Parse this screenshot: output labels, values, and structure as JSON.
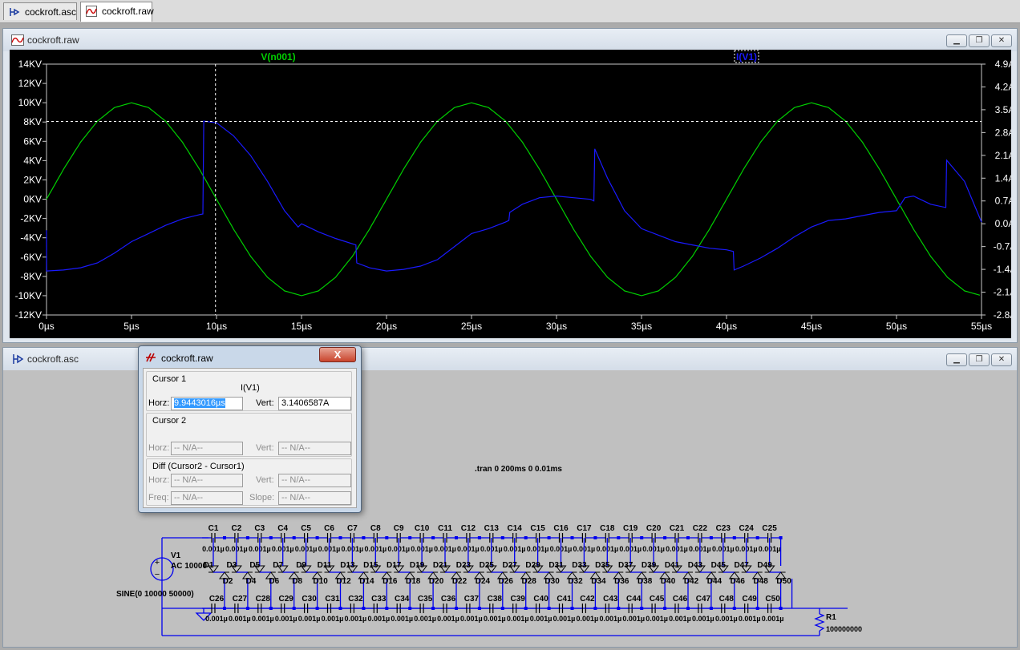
{
  "tabs": [
    {
      "label": "cockroft.asc",
      "icon": "schematic-icon",
      "active": false
    },
    {
      "label": "cockroft.raw",
      "icon": "waveform-icon",
      "active": true
    }
  ],
  "waveform_window": {
    "title": "cockroft.raw"
  },
  "schematic_window": {
    "title": "cockroft.asc"
  },
  "colors": {
    "voltage_trace": "#00d000",
    "current_trace": "#1a1aff",
    "plot_bg": "#000000",
    "axis_text": "#ffffff",
    "wire": "#0000ee",
    "schematic_bg": "#c0c0c0"
  },
  "plot": {
    "left_ticks": [
      "14KV",
      "12KV",
      "10KV",
      "8KV",
      "6KV",
      "4KV",
      "2KV",
      "0KV",
      "-2KV",
      "-4KV",
      "-6KV",
      "-8KV",
      "-10KV",
      "-12KV"
    ],
    "right_ticks": [
      "4.9A",
      "4.2A",
      "3.5A",
      "2.8A",
      "2.1A",
      "1.4A",
      "0.7A",
      "0.0A",
      "-0.7A",
      "-1.4A",
      "-2.1A",
      "-2.8A"
    ],
    "x_ticks": [
      "0µs",
      "5µs",
      "10µs",
      "15µs",
      "20µs",
      "25µs",
      "30µs",
      "35µs",
      "40µs",
      "45µs",
      "50µs",
      "55µs"
    ],
    "trace_labels": {
      "voltage": "V(n001)",
      "current": "I(V1)"
    }
  },
  "chart_data": {
    "type": "line",
    "xlabel": "",
    "ylabel": "",
    "xlim": [
      0,
      55
    ],
    "ylim_left": [
      -12,
      14
    ],
    "ylim_right": [
      -2.8,
      4.9
    ],
    "grid": false,
    "cursor": {
      "x_us": 9.94,
      "y_current_A": 3.14
    },
    "series": [
      {
        "name": "V(n001)",
        "axis": "left",
        "unit": "KV",
        "x": [
          0,
          1,
          2,
          3,
          4,
          5,
          6,
          7,
          8,
          9,
          10,
          11,
          12,
          13,
          14,
          15,
          16,
          17,
          18,
          19,
          20,
          21,
          22,
          23,
          24,
          25,
          26,
          27,
          28,
          29,
          30,
          31,
          32,
          33,
          34,
          35,
          36,
          37,
          38,
          39,
          40,
          41,
          42,
          43,
          44,
          45,
          46,
          47,
          48,
          49,
          50,
          51,
          52,
          53,
          54,
          55
        ],
        "y": [
          0,
          3.1,
          5.9,
          8.1,
          9.5,
          10,
          9.5,
          8.1,
          5.9,
          3.1,
          0,
          -3.1,
          -5.9,
          -8.1,
          -9.5,
          -10,
          -9.5,
          -8.1,
          -5.9,
          -3.1,
          0,
          3.1,
          5.9,
          8.1,
          9.5,
          10,
          9.5,
          8.1,
          5.9,
          3.1,
          0,
          -3.1,
          -5.9,
          -8.1,
          -9.5,
          -10,
          -9.5,
          -8.1,
          -5.9,
          -3.1,
          0,
          3.1,
          5.9,
          8.1,
          9.5,
          10,
          9.5,
          8.1,
          5.9,
          3.1,
          0,
          -3.1,
          -5.9,
          -8.1,
          -9.5,
          -10
        ]
      },
      {
        "name": "I(V1)",
        "axis": "right",
        "unit": "A",
        "x": [
          0,
          0.01,
          1,
          2,
          3,
          4,
          5,
          6,
          7,
          8,
          9,
          9.2,
          9.25,
          10,
          11,
          12,
          13,
          14,
          14.8,
          15,
          16,
          17,
          18.2,
          18.25,
          19,
          20,
          21,
          22,
          23,
          24,
          25,
          26,
          27,
          27.2,
          27.25,
          28,
          29,
          30,
          31,
          32,
          32.2,
          32.25,
          33,
          34,
          35,
          36,
          37,
          38,
          39,
          40,
          40.4,
          40.45,
          41,
          42,
          43,
          44,
          45,
          46,
          47,
          48,
          49,
          50,
          50.5,
          51,
          52,
          52.9,
          52.95,
          54,
          55
        ],
        "y": [
          -0.2,
          -1.45,
          -1.42,
          -1.35,
          -1.2,
          -0.9,
          -0.55,
          -0.3,
          -0.05,
          0.15,
          0.28,
          0.3,
          3.15,
          3.1,
          2.7,
          2.1,
          1.3,
          0.4,
          -0.1,
          0,
          -0.25,
          -0.45,
          -0.65,
          -1.2,
          -1.35,
          -1.45,
          -1.4,
          -1.3,
          -1.1,
          -0.7,
          -0.3,
          -0.15,
          0.05,
          0.1,
          0.35,
          0.6,
          0.8,
          0.85,
          0.8,
          0.75,
          0.7,
          2.3,
          1.4,
          0.4,
          -0.15,
          -0.35,
          -0.55,
          -0.65,
          -0.75,
          -0.8,
          -0.85,
          -1.42,
          -1.3,
          -1.05,
          -0.75,
          -0.4,
          -0.1,
          0.1,
          0.15,
          0.25,
          0.35,
          0.4,
          0.8,
          0.85,
          0.6,
          0.5,
          1.95,
          1.3,
          0.05
        ]
      }
    ]
  },
  "cursor_dialog": {
    "title": "cockroft.raw",
    "close_label": "X",
    "cursor1": {
      "heading": "Cursor 1",
      "trace": "I(V1)",
      "horz_label": "Horz:",
      "horz_value": "9.9443016µs",
      "vert_label": "Vert:",
      "vert_value": "3.1406587A"
    },
    "cursor2": {
      "heading": "Cursor 2",
      "horz_label": "Horz:",
      "horz_value": "-- N/A--",
      "vert_label": "Vert:",
      "vert_value": "-- N/A--"
    },
    "diff": {
      "heading": "Diff (Cursor2 - Cursor1)",
      "horz_label": "Horz:",
      "horz_value": "-- N/A--",
      "vert_label": "Vert:",
      "vert_value": "-- N/A--",
      "freq_label": "Freq:",
      "freq_value": "-- N/A--",
      "slope_label": "Slope:",
      "slope_value": "-- N/A--"
    }
  },
  "schematic": {
    "directive": ".tran 0 200ms 0 0.01ms",
    "v1_name": "V1",
    "v1_ac": "AC 10000",
    "v1_sine": "SINE(0 10000 50000)",
    "r1_name": "R1",
    "r1_value": "100000000",
    "cap_value": "0.001µ",
    "cap_value_short": "0.001µ",
    "top_caps": [
      "C1",
      "C2",
      "C3",
      "C4",
      "C5",
      "C6",
      "C7",
      "C8",
      "C9",
      "C10",
      "C11",
      "C12",
      "C13",
      "C14",
      "C15",
      "C16",
      "C17",
      "C18",
      "C19",
      "C20",
      "C21",
      "C22",
      "C23",
      "C24",
      "C25"
    ],
    "bottom_caps": [
      "C26",
      "C27",
      "C28",
      "C29",
      "C30",
      "C31",
      "C32",
      "C33",
      "C34",
      "C35",
      "C36",
      "C37",
      "C38",
      "C39",
      "C40",
      "C41",
      "C42",
      "C43",
      "C44",
      "C45",
      "C46",
      "C47",
      "C48",
      "C49",
      "C50"
    ],
    "odd_diodes": [
      "D1",
      "D3",
      "D5",
      "D7",
      "D9",
      "D11",
      "D13",
      "D15",
      "D17",
      "D19",
      "D21",
      "D23",
      "D25",
      "D27",
      "D29",
      "D31",
      "D33",
      "D35",
      "D37",
      "D39",
      "D41",
      "D43",
      "D45",
      "D47",
      "D49"
    ],
    "even_diodes": [
      "D2",
      "D4",
      "D6",
      "D8",
      "D10",
      "D12",
      "D14",
      "D16",
      "D18",
      "D20",
      "D22",
      "D24",
      "D26",
      "D28",
      "D30",
      "D32",
      "D34",
      "D36",
      "D38",
      "D40",
      "D42",
      "D44",
      "D46",
      "D48",
      "D50"
    ]
  }
}
